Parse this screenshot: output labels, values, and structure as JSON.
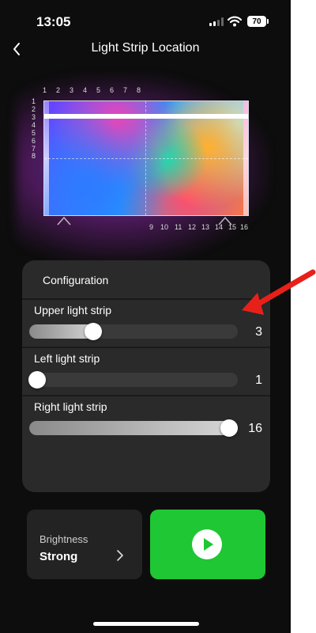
{
  "status": {
    "time": "13:05",
    "battery": "70"
  },
  "nav": {
    "title": "Light Strip Location",
    "back_icon": "chevron-left-icon"
  },
  "preview": {
    "top_numbers": [
      "1",
      "2",
      "3",
      "4",
      "5",
      "6",
      "7",
      "8"
    ],
    "side_numbers": [
      "1",
      "2",
      "3",
      "4",
      "5",
      "6",
      "7",
      "8"
    ],
    "bottom_numbers": [
      "9",
      "10",
      "11",
      "12",
      "13",
      "14",
      "15",
      "16"
    ]
  },
  "config": {
    "title": "Configuration",
    "rows": [
      {
        "label": "Upper light strip",
        "value": "3"
      },
      {
        "label": "Left light strip",
        "value": "1"
      },
      {
        "label": "Right light strip",
        "value": "16"
      }
    ]
  },
  "brightness": {
    "label": "Brightness",
    "value": "Strong"
  },
  "colors": {
    "accent_green": "#1ec733",
    "annotation_red": "#e8201a"
  }
}
